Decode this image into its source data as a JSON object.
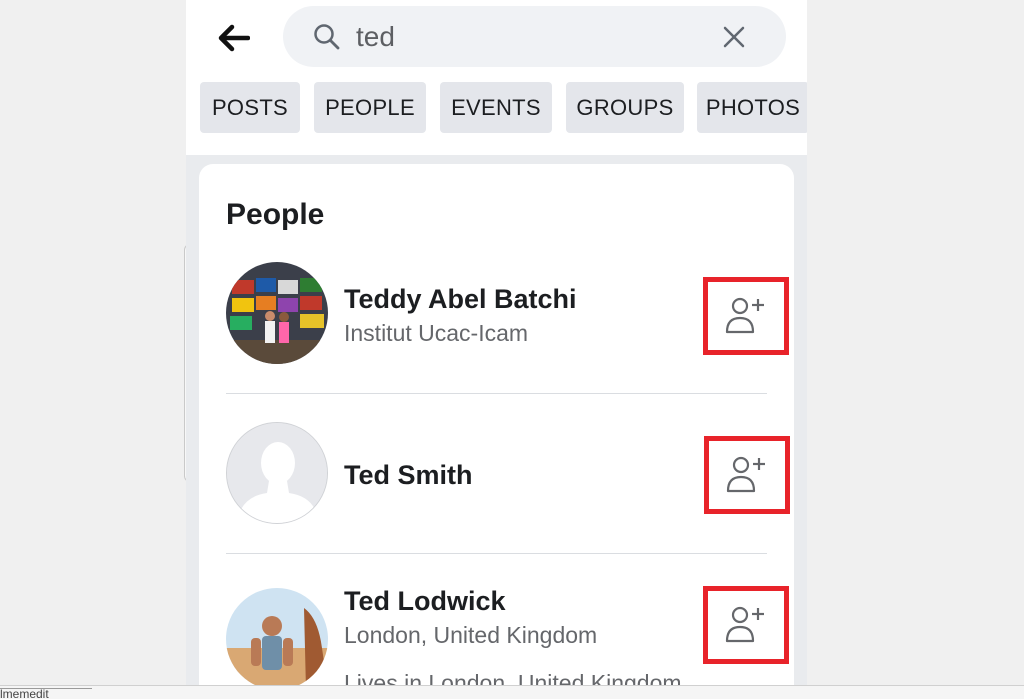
{
  "search": {
    "query": "ted",
    "back_icon": "arrow-left-icon",
    "search_icon": "magnifier-icon",
    "clear_icon": "close-icon"
  },
  "tabs": [
    {
      "label": "POSTS"
    },
    {
      "label": "PEOPLE"
    },
    {
      "label": "EVENTS"
    },
    {
      "label": "GROUPS"
    },
    {
      "label": "PHOTOS"
    }
  ],
  "people_section": {
    "title": "People",
    "results": [
      {
        "name": "Teddy Abel Batchi",
        "subtitle": "Institut Ucac-Icam",
        "avatar": "photo-flags",
        "action_icon": "add-friend-icon"
      },
      {
        "name": "Ted Smith",
        "subtitle": "",
        "avatar": "default-silhouette",
        "action_icon": "add-friend-icon"
      },
      {
        "name": "Ted Lodwick",
        "subtitle": "London, United Kingdom",
        "extra": "Lives in London, United Kingdom",
        "avatar": "photo-desert",
        "action_icon": "add-friend-icon"
      }
    ]
  },
  "colors": {
    "highlight": "#e8232a",
    "tab_bg": "#e4e6eb",
    "search_bg": "#f0f2f5",
    "page_bg": "#e9ebee"
  },
  "status_bar": {
    "text": "lmemedit"
  }
}
